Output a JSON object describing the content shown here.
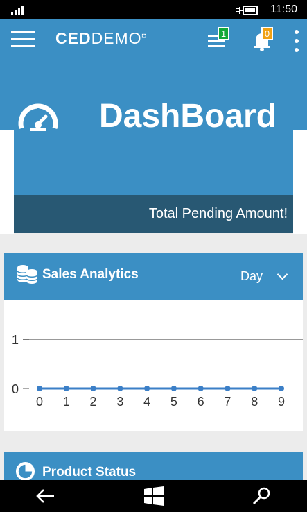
{
  "status_bar": {
    "time": "11:50",
    "icons": [
      "signal-icon",
      "battery-charging-icon"
    ]
  },
  "app_bar": {
    "brand_prefix": "CED",
    "brand_suffix": "DEMO",
    "menu_icon": "hamburger-menu-icon",
    "list_icon": "list-icon",
    "list_badge": "1",
    "notification_icon": "bell-icon",
    "notification_badge": "0",
    "more_icon": "more-vertical-icon"
  },
  "dashboard": {
    "title": "DashBoard",
    "subtitle": "Total Pending Amount!",
    "icon": "speedometer-icon",
    "colors": {
      "primary": "#3b8fc4",
      "band": "#285873"
    }
  },
  "sales_analytics": {
    "title": "Sales Analytics",
    "icon": "stacked-coins-icon",
    "period": "Day",
    "chevron_icon": "chevron-down-icon"
  },
  "chart_data": {
    "type": "line",
    "title": "",
    "xlabel": "",
    "ylabel": "",
    "x": [
      0,
      1,
      2,
      3,
      4,
      5,
      6,
      7,
      8,
      9
    ],
    "series": [
      {
        "values": [
          0,
          0,
          0,
          0,
          0,
          0,
          0,
          0,
          0,
          0
        ]
      }
    ],
    "xtick_labels": [
      "0",
      "1",
      "2",
      "3",
      "4",
      "5",
      "6",
      "7",
      "8",
      "9"
    ],
    "ytick_labels": [
      "0",
      "1"
    ],
    "ylim": [
      0,
      1
    ],
    "xlim": [
      0,
      9
    ],
    "grid": true,
    "colors": {
      "line": "#3b7fc7",
      "grid": "#999999"
    }
  },
  "product_status": {
    "title": "Product Status",
    "icon": "pie-chart-icon"
  },
  "navigation": {
    "back_icon": "back-arrow-icon",
    "windows_icon": "windows-logo-icon",
    "search_icon": "search-icon"
  }
}
